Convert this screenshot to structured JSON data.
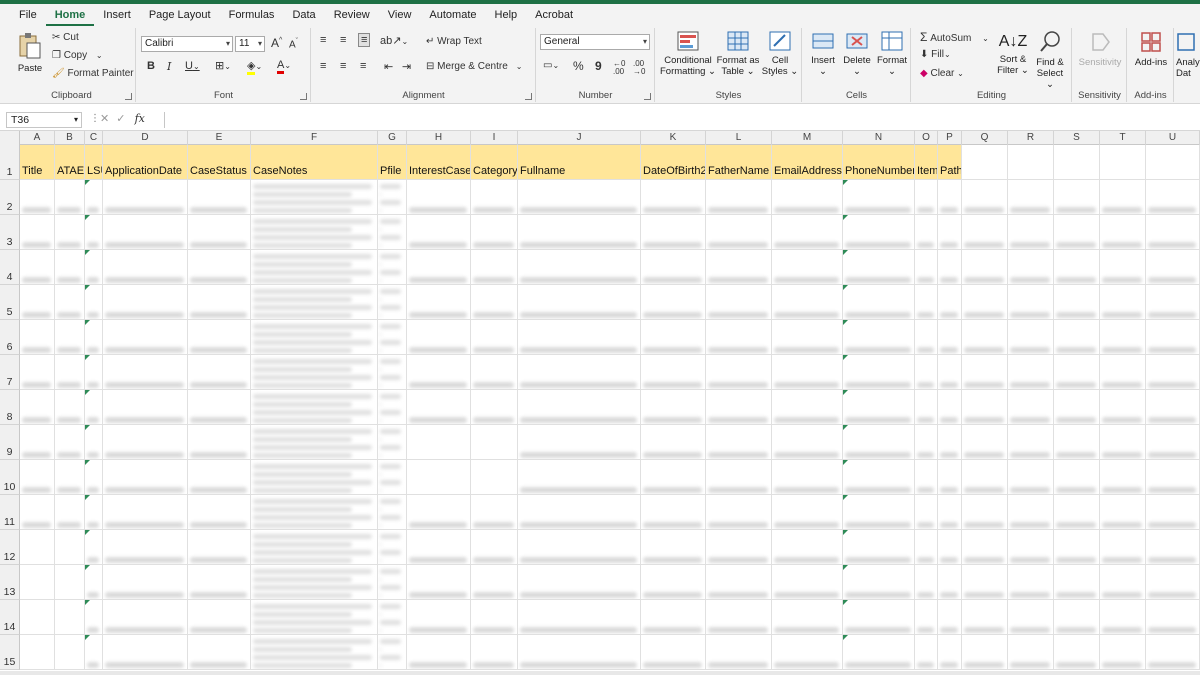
{
  "menu": [
    "File",
    "Home",
    "Insert",
    "Page Layout",
    "Formulas",
    "Data",
    "Review",
    "View",
    "Automate",
    "Help",
    "Acrobat"
  ],
  "active_menu": "Home",
  "ribbon": {
    "clipboard": {
      "name": "Clipboard",
      "paste": "Paste",
      "cut": "Cut",
      "copy": "Copy",
      "format_painter": "Format Painter"
    },
    "font": {
      "name": "Font",
      "family": "Calibri",
      "size": "11",
      "bold": "B",
      "italic": "I",
      "underline": "U",
      "grow": "A",
      "shrink": "A"
    },
    "alignment": {
      "name": "Alignment",
      "wrap_text": "Wrap Text",
      "merge_centre": "Merge & Centre"
    },
    "number": {
      "name": "Number",
      "format": "General",
      "percent": "%",
      "comma": "9"
    },
    "styles": {
      "name": "Styles",
      "conditional_1": "Conditional",
      "conditional_2": "Formatting",
      "format_as_1": "Format as",
      "format_as_2": "Table",
      "cell_1": "Cell",
      "cell_2": "Styles"
    },
    "cells": {
      "name": "Cells",
      "insert": "Insert",
      "delete": "Delete",
      "format": "Format"
    },
    "editing": {
      "name": "Editing",
      "autosum": "AutoSum",
      "fill": "Fill",
      "clear": "Clear",
      "sort_1": "Sort &",
      "sort_2": "Filter",
      "find_1": "Find &",
      "find_2": "Select"
    },
    "sensitivity": {
      "name": "Sensitivity",
      "label": "Sensitivity"
    },
    "addins": {
      "name": "Add-ins",
      "label": "Add-ins",
      "analyze_1": "Analy",
      "analyze_2": "Dat"
    }
  },
  "formula_bar": {
    "name_box": "T36",
    "fx": "fx",
    "content": ""
  },
  "columns": [
    "A",
    "B",
    "C",
    "D",
    "E",
    "F",
    "G",
    "H",
    "I",
    "J",
    "K",
    "L",
    "M",
    "N",
    "O",
    "P",
    "Q",
    "R",
    "S",
    "T",
    "U"
  ],
  "rows": [
    "1",
    "2",
    "3",
    "4",
    "5",
    "6",
    "7",
    "8",
    "9",
    "10",
    "11",
    "12",
    "13",
    "14",
    "15"
  ],
  "headers": [
    "Title",
    "ATAE",
    "LSU",
    "ApplicationDate",
    "CaseStatus",
    "CaseNotes",
    "Pfile",
    "InterestCase",
    "Category",
    "Fullname",
    "DateOfBirth2",
    "FatherName",
    "EmailAddress",
    "PhoneNumber",
    "Item",
    "Path"
  ],
  "colors": {
    "accent": "#1e7145",
    "header_fill": "#ffe699"
  }
}
